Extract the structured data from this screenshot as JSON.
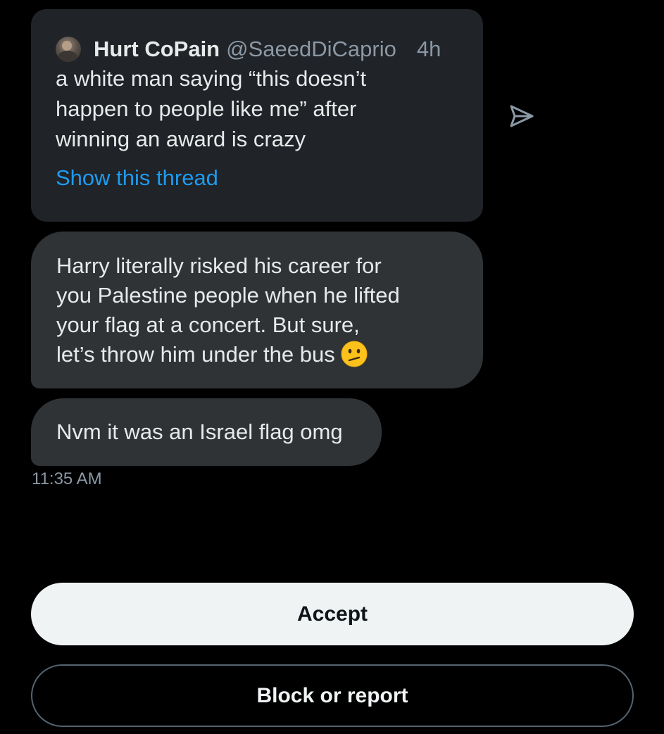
{
  "quoted_tweet": {
    "author_name": "Hurt CoPain",
    "author_handle": "@SaeedDiCaprio",
    "time": "4h",
    "text": "a white man saying “this doesn’t\nhappen to people like me” after\nwinning an award is crazy",
    "show_thread_label": "Show this thread"
  },
  "messages": [
    {
      "text": "Harry literally risked his career for\nyou Palestine people when he lifted\nyour flag at a concert. But sure,\nlet’s throw him under the bus",
      "emoji": "confused-face-emoji"
    },
    {
      "text": "Nvm it was an Israel flag omg"
    }
  ],
  "timestamp": "11:35 AM",
  "actions": {
    "accept_label": "Accept",
    "block_label": "Block or report"
  },
  "icons": {
    "share": "share-dm-icon",
    "avatar": "author-avatar"
  },
  "colors": {
    "link": "#1d9bf0",
    "bubble": "#2f3336",
    "quoted_card": "#202327",
    "muted_text": "#8b98a5"
  }
}
